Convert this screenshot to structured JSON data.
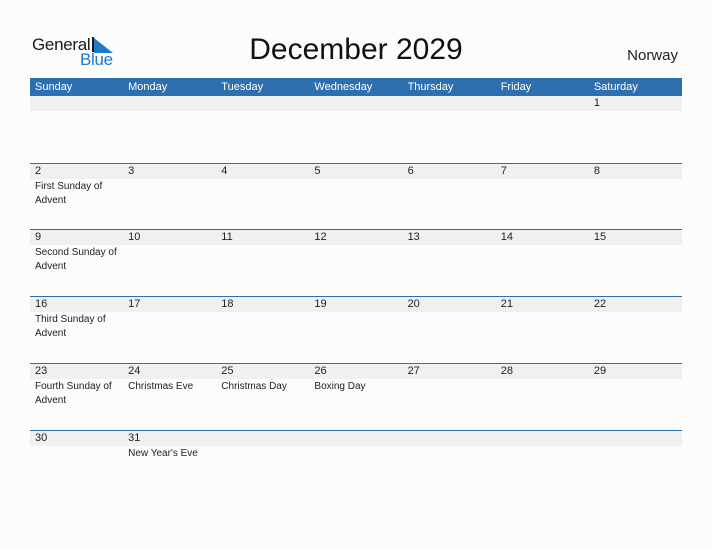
{
  "logo": {
    "text_general": "General",
    "text_blue": "Blue",
    "icon": "triangle-flag-icon"
  },
  "title": "December 2029",
  "country": "Norway",
  "weekdays": [
    "Sunday",
    "Monday",
    "Tuesday",
    "Wednesday",
    "Thursday",
    "Friday",
    "Saturday"
  ],
  "weeks": [
    [
      {
        "day": "",
        "event": ""
      },
      {
        "day": "",
        "event": ""
      },
      {
        "day": "",
        "event": ""
      },
      {
        "day": "",
        "event": ""
      },
      {
        "day": "",
        "event": ""
      },
      {
        "day": "",
        "event": ""
      },
      {
        "day": "1",
        "event": ""
      }
    ],
    [
      {
        "day": "2",
        "event": "First Sunday of Advent"
      },
      {
        "day": "3",
        "event": ""
      },
      {
        "day": "4",
        "event": ""
      },
      {
        "day": "5",
        "event": ""
      },
      {
        "day": "6",
        "event": ""
      },
      {
        "day": "7",
        "event": ""
      },
      {
        "day": "8",
        "event": ""
      }
    ],
    [
      {
        "day": "9",
        "event": "Second Sunday of Advent"
      },
      {
        "day": "10",
        "event": ""
      },
      {
        "day": "11",
        "event": ""
      },
      {
        "day": "12",
        "event": ""
      },
      {
        "day": "13",
        "event": ""
      },
      {
        "day": "14",
        "event": ""
      },
      {
        "day": "15",
        "event": ""
      }
    ],
    [
      {
        "day": "16",
        "event": "Third Sunday of Advent"
      },
      {
        "day": "17",
        "event": ""
      },
      {
        "day": "18",
        "event": ""
      },
      {
        "day": "19",
        "event": ""
      },
      {
        "day": "20",
        "event": ""
      },
      {
        "day": "21",
        "event": ""
      },
      {
        "day": "22",
        "event": ""
      }
    ],
    [
      {
        "day": "23",
        "event": "Fourth Sunday of Advent"
      },
      {
        "day": "24",
        "event": "Christmas Eve"
      },
      {
        "day": "25",
        "event": "Christmas Day"
      },
      {
        "day": "26",
        "event": "Boxing Day"
      },
      {
        "day": "27",
        "event": ""
      },
      {
        "day": "28",
        "event": ""
      },
      {
        "day": "29",
        "event": ""
      }
    ],
    [
      {
        "day": "30",
        "event": ""
      },
      {
        "day": "31",
        "event": "New Year's Eve"
      },
      {
        "day": "",
        "event": ""
      },
      {
        "day": "",
        "event": ""
      },
      {
        "day": "",
        "event": ""
      },
      {
        "day": "",
        "event": ""
      },
      {
        "day": "",
        "event": ""
      }
    ]
  ]
}
